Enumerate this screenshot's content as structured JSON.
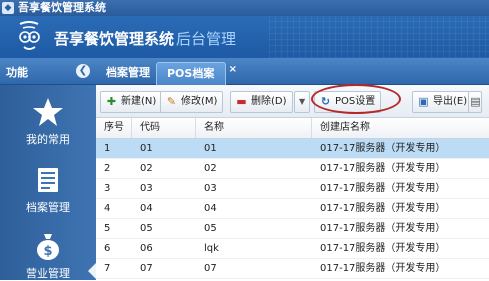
{
  "window": {
    "title": "吾享餐饮管理系统"
  },
  "banner": {
    "app_name": "吾享餐饮管理系统",
    "app_sub": "后台管理"
  },
  "nav": {
    "panel_title": "功能",
    "collapse_icon": "chevron-left-icon",
    "tabs": [
      {
        "label": "档案管理",
        "active": false
      },
      {
        "label": "POS档案",
        "active": true,
        "close": "×"
      }
    ]
  },
  "sidebar": {
    "items": [
      {
        "label": "我的常用",
        "icon": "star-icon"
      },
      {
        "label": "档案管理",
        "icon": "document-icon"
      },
      {
        "label": "营业管理",
        "icon": "money-bag-icon"
      }
    ]
  },
  "toolbar": {
    "new_label": "新建(N)",
    "edit_label": "修改(M)",
    "delete_label": "删除(D)",
    "pos_label": "POS设置",
    "export_label": "导出(E)"
  },
  "table": {
    "columns": [
      "序号",
      "代码",
      "名称",
      "创建店名称"
    ],
    "rows": [
      {
        "no": "1",
        "code": "01",
        "name": "01",
        "store": "017-17服务器（开发专用）",
        "selected": true
      },
      {
        "no": "2",
        "code": "02",
        "name": "02",
        "store": "017-17服务器（开发专用）",
        "selected": false
      },
      {
        "no": "3",
        "code": "03",
        "name": "03",
        "store": "017-17服务器（开发专用）",
        "selected": false
      },
      {
        "no": "4",
        "code": "04",
        "name": "04",
        "store": "017-17服务器（开发专用）",
        "selected": false
      },
      {
        "no": "5",
        "code": "05",
        "name": "05",
        "store": "017-17服务器（开发专用）",
        "selected": false
      },
      {
        "no": "6",
        "code": "06",
        "name": "lqk",
        "store": "017-17服务器（开发专用）",
        "selected": false
      },
      {
        "no": "7",
        "code": "07",
        "name": "07",
        "store": "017-17服务器（开发专用）",
        "selected": false
      }
    ]
  },
  "colors": {
    "accent": "#2b6bb5",
    "selected_row": "#bcdcf5",
    "highlight_ring": "#b52828"
  }
}
